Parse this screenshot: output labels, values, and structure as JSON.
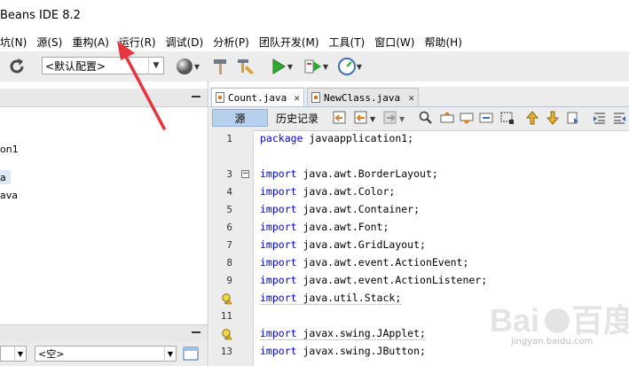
{
  "window": {
    "title": "Beans IDE 8.2"
  },
  "menubar": {
    "items": [
      "坑(N)",
      "源(S)",
      "重构(A)",
      "运行(R)",
      "调试(D)",
      "分析(P)",
      "团队开发(M)",
      "工具(T)",
      "窗口(W)",
      "帮助(H)"
    ]
  },
  "toolbar": {
    "config_value": "<默认配置>"
  },
  "left_panel": {
    "tree_items": [
      "on1",
      "a",
      "ava"
    ],
    "bottom_select_value": "<空>"
  },
  "editor": {
    "tabs": [
      {
        "label": "Count.java",
        "close": "✕"
      },
      {
        "label": "NewClass.java",
        "close": "✕"
      }
    ],
    "source_tab": "源",
    "history_tab": "历史记录",
    "lines": [
      {
        "num": "1",
        "kw": "package",
        "rest": " javaapplication1;"
      },
      {
        "num": "",
        "kw": "",
        "rest": ""
      },
      {
        "num": "3",
        "kw": "import",
        "rest": " java.awt.BorderLayout;"
      },
      {
        "num": "4",
        "kw": "import",
        "rest": " java.awt.Color;"
      },
      {
        "num": "5",
        "kw": "import",
        "rest": " java.awt.Container;"
      },
      {
        "num": "6",
        "kw": "import",
        "rest": " java.awt.Font;"
      },
      {
        "num": "7",
        "kw": "import",
        "rest": " java.awt.GridLayout;"
      },
      {
        "num": "8",
        "kw": "import",
        "rest": " java.awt.event.ActionEvent;"
      },
      {
        "num": "9",
        "kw": "import",
        "rest": " java.awt.event.ActionListener;"
      },
      {
        "num": "",
        "kw": "import",
        "rest": " java.util.Stack;"
      },
      {
        "num": "11",
        "kw": "",
        "rest": ""
      },
      {
        "num": "",
        "kw": "import",
        "rest": " javax.swing.JApplet;"
      },
      {
        "num": "13",
        "kw": "import",
        "rest": " javax.swing.JButton;"
      }
    ]
  },
  "watermark": {
    "text": "jingyan.baidu.com"
  },
  "colors": {
    "keyword": "#0000e6",
    "selected_tab": "#b7d0ee",
    "arrow": "#e8353b"
  }
}
